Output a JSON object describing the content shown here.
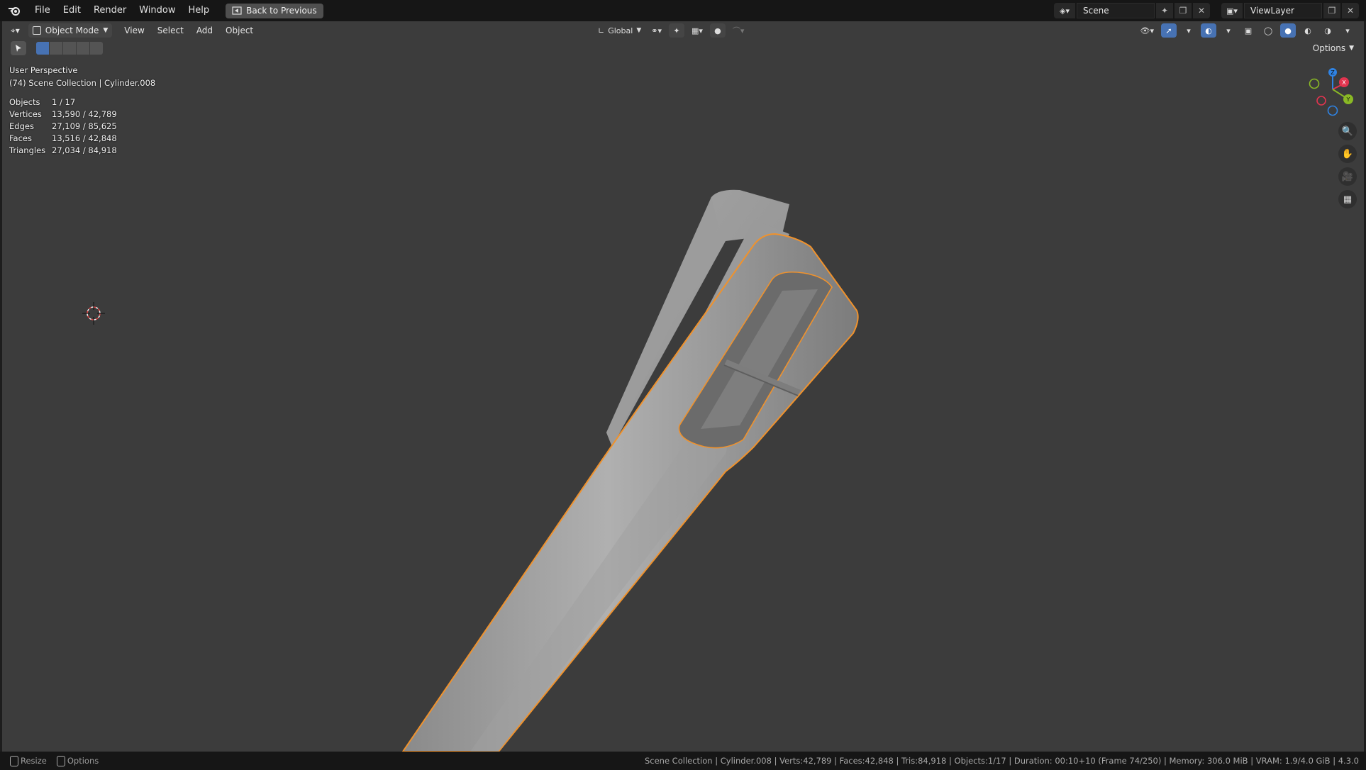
{
  "topbar": {
    "menus": [
      "File",
      "Edit",
      "Render",
      "Window",
      "Help"
    ],
    "back_button": "Back to Previous",
    "scene_name": "Scene",
    "view_layer_name": "ViewLayer"
  },
  "viewport_header": {
    "mode": "Object Mode",
    "menus": [
      "View",
      "Select",
      "Add",
      "Object"
    ],
    "transform_orientation": "Global",
    "options_label": "Options"
  },
  "overlay": {
    "view_name": "User Perspective",
    "collection_info": "(74) Scene Collection | Cylinder.008",
    "stats": [
      {
        "label": "Objects",
        "value": "1 / 17"
      },
      {
        "label": "Vertices",
        "value": "13,590 / 42,789"
      },
      {
        "label": "Edges",
        "value": "27,109 / 85,625"
      },
      {
        "label": "Faces",
        "value": "13,516 / 42,848"
      },
      {
        "label": "Triangles",
        "value": "27,034 / 84,918"
      }
    ]
  },
  "gizmo": {
    "x": "X",
    "y": "Y",
    "z": "Z"
  },
  "statusbar": {
    "left": [
      {
        "label": "Resize"
      },
      {
        "label": "Options"
      }
    ],
    "right": "Scene Collection | Cylinder.008 | Verts:42,789 | Faces:42,848 | Tris:84,918 | Objects:1/17 | Duration: 00:10+10 (Frame 74/250) | Memory: 306.0 MiB | VRAM: 1.9/4.0 GiB | 4.3.0"
  },
  "colors": {
    "viewport_bg": "#3c3c3c",
    "selection_outline": "#f0922c",
    "active_blue": "#4772b3",
    "axis_x": "#e2344f",
    "axis_y": "#8ab925",
    "axis_z": "#2f83e3"
  }
}
